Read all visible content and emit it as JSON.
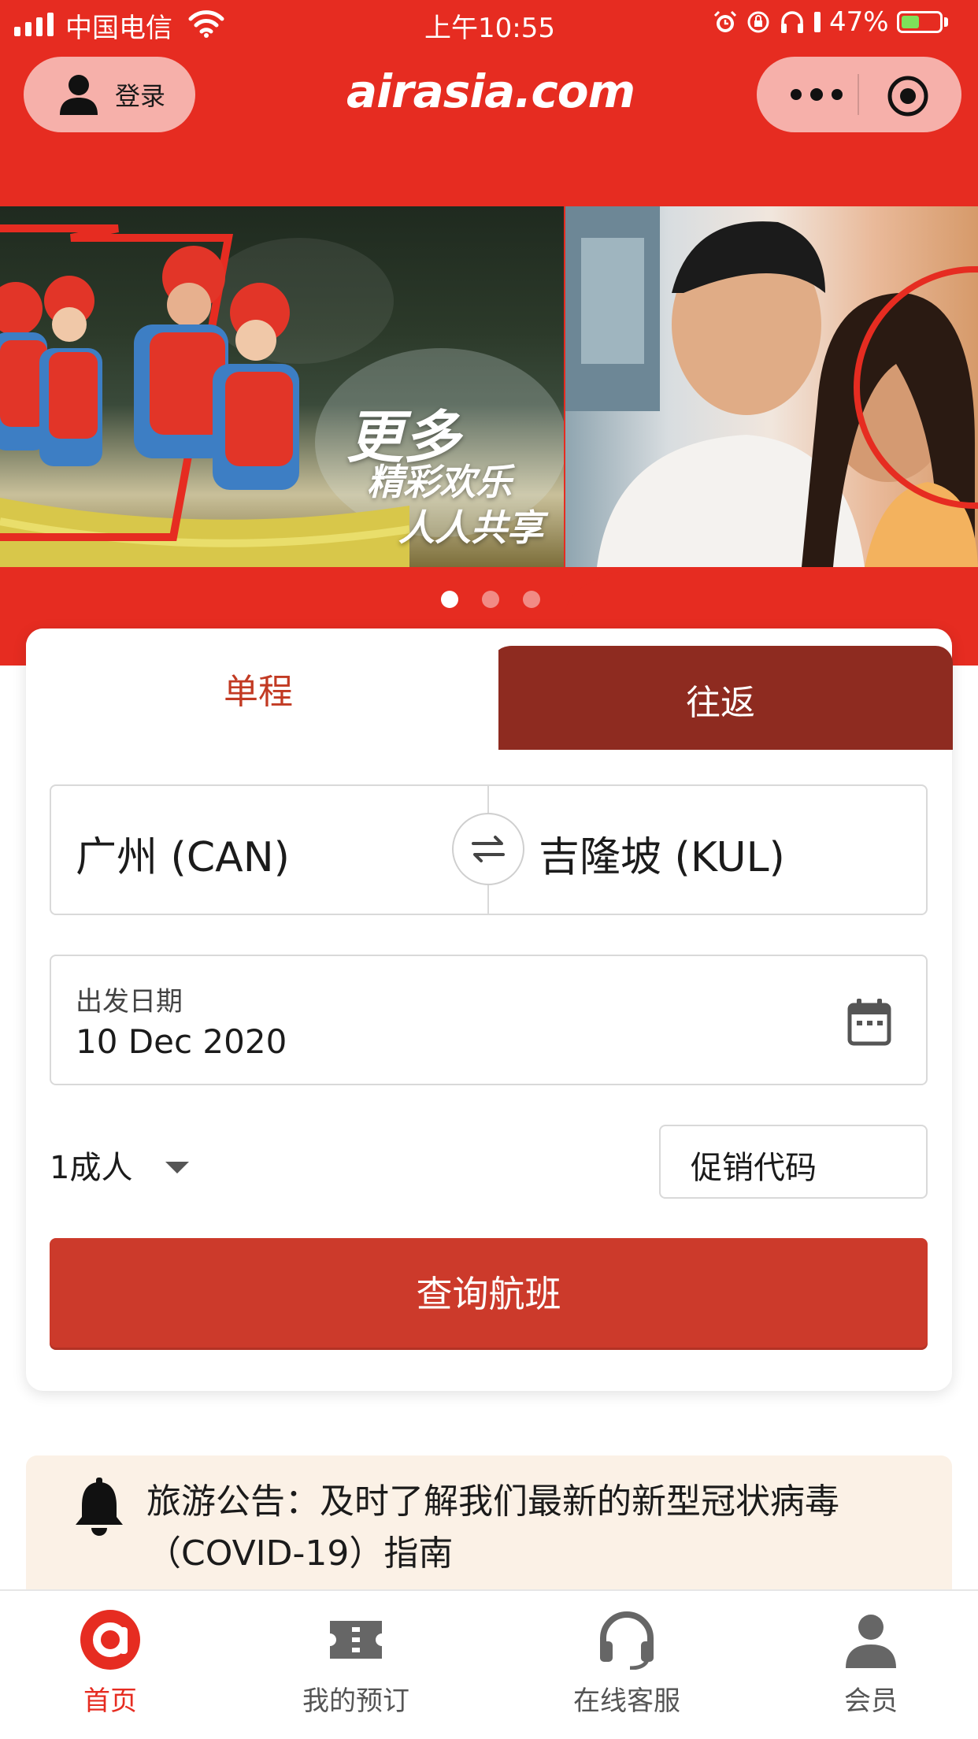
{
  "status_bar": {
    "carrier": "中国电信",
    "time": "上午10:55",
    "battery": "47%",
    "battery_level": 0.47
  },
  "header": {
    "login_label": "登录",
    "logo": "airasia.com",
    "more_icon": "more-dots-icon",
    "target_icon": "target-icon"
  },
  "banner": {
    "line1": "更多",
    "line2": "精彩欢乐",
    "line3": "人人共享",
    "slide_count": 3,
    "active_slide": 1
  },
  "booking": {
    "tabs": [
      {
        "label": "单程",
        "active": true
      },
      {
        "label": "往返",
        "active": false
      }
    ],
    "from": "广州 (CAN)",
    "to": "吉隆坡 (KUL)",
    "date_label": "出发日期",
    "date_value": "10 Dec 2020",
    "passengers": "1成人",
    "promo_placeholder": "促销代码",
    "search_label": "查询航班"
  },
  "advisory": {
    "text": "旅游公告：及时了解我们最新的新型冠状病毒（COVID-19）指南"
  },
  "tabbar": {
    "items": [
      {
        "label": "首页",
        "icon": "airasia-home-icon",
        "active": true
      },
      {
        "label": "我的预订",
        "icon": "ticket-icon",
        "active": false
      },
      {
        "label": "在线客服",
        "icon": "headset-icon",
        "active": false
      },
      {
        "label": "会员",
        "icon": "member-icon",
        "active": false
      }
    ]
  },
  "colors": {
    "brand_red": "#e62c21",
    "tab_inactive": "#8e2b20",
    "search_button": "#cc3a2b",
    "advisory_bg": "#fbf1e6"
  }
}
